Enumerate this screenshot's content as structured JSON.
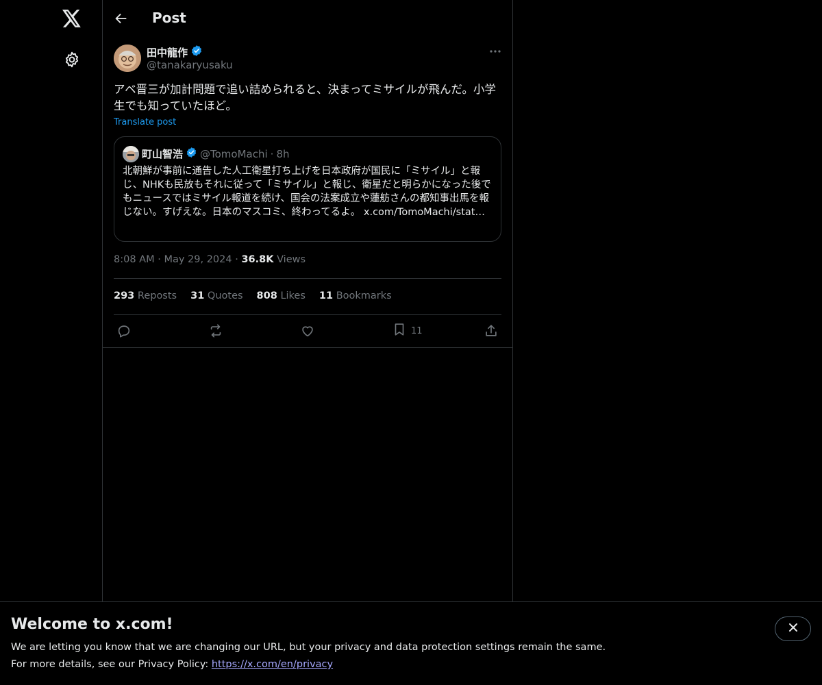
{
  "header": {
    "title": "Post"
  },
  "post": {
    "author_name": "田中龍作",
    "author_handle": "@tanakaryusaku",
    "text": "アベ晋三が加計問題で追い詰められると、決まってミサイルが飛んだ。小学生でも知っていたほど。",
    "translate_label": "Translate post",
    "quote": {
      "author_name": "町山智浩",
      "author_handle": "@TomoMachi",
      "separator": "·",
      "time": "8h",
      "text": "北朝鮮が事前に通告した人工衛星打ち上げを日本政府が国民に「ミサイル」と報じ、NHKも民放もそれに従って「ミサイル」と報じ、衛星だと明らかになった後でもニュースではミサイル報道を続け、国会の法案成立や蓮舫さんの都知事出馬を報じない。すげえな。日本のマスコミ、終わってるよ。 x.com/TomoMachi/stat…"
    },
    "time": "8:08 AM",
    "date": "May 29, 2024",
    "separator": "·",
    "views_count": "36.8K",
    "views_label": "Views",
    "stats": {
      "reposts_count": "293",
      "reposts_label": "Reposts",
      "quotes_count": "31",
      "quotes_label": "Quotes",
      "likes_count": "808",
      "likes_label": "Likes",
      "bookmarks_count": "11",
      "bookmarks_label": "Bookmarks"
    },
    "actions": {
      "bookmark_count": "11"
    }
  },
  "banner": {
    "title": "Welcome to x.com!",
    "line1": "We are letting you know that we are changing our URL, but your privacy and data protection settings remain the same.",
    "line2_prefix": "For more details, see our Privacy Policy:",
    "link": "https://x.com/en/privacy"
  },
  "icons": {
    "logo": "x-logo-icon",
    "settings": "gear-icon",
    "back": "arrow-left-icon",
    "verified": "verified-badge-icon",
    "more": "more-horizontal-icon",
    "reply": "reply-icon",
    "repost": "repost-icon",
    "like": "heart-icon",
    "bookmark": "bookmark-icon",
    "share": "share-icon",
    "close": "close-icon"
  },
  "colors": {
    "accent": "#1d9bf0",
    "background": "#000000",
    "border": "#2f3336",
    "muted": "#71767b",
    "link": "#a7a9ff"
  }
}
